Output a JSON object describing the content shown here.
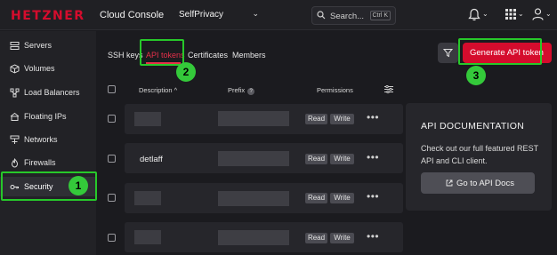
{
  "topbar": {
    "logo": "HETZNER",
    "app_title": "Cloud Console",
    "project": "SelfPrivacy",
    "search_placeholder": "Search...",
    "search_shortcut": "Ctrl K"
  },
  "sidebar": {
    "items": [
      {
        "label": "Servers",
        "icon": "server-icon"
      },
      {
        "label": "Volumes",
        "icon": "volume-icon"
      },
      {
        "label": "Load Balancers",
        "icon": "load-balancer-icon"
      },
      {
        "label": "Floating IPs",
        "icon": "floating-ip-icon"
      },
      {
        "label": "Networks",
        "icon": "network-icon"
      },
      {
        "label": "Firewalls",
        "icon": "firewall-icon"
      },
      {
        "label": "Security",
        "icon": "key-icon",
        "active": true
      }
    ]
  },
  "tabs": [
    {
      "label": "SSH keys"
    },
    {
      "label": "API tokens",
      "active": true
    },
    {
      "label": "Certificates"
    },
    {
      "label": "Members"
    }
  ],
  "actions": {
    "generate_label": "Generate API token"
  },
  "table": {
    "headers": {
      "description": "Description",
      "prefix": "Prefix",
      "permissions": "Permissions"
    },
    "sort_indicator": "^",
    "help_glyph": "?",
    "rows": [
      {
        "description": "",
        "perm_read": "Read",
        "perm_write": "Write",
        "more": "•••"
      },
      {
        "description": "detlaff",
        "perm_read": "Read",
        "perm_write": "Write",
        "more": "•••"
      },
      {
        "description": "",
        "perm_read": "Read",
        "perm_write": "Write",
        "more": "•••"
      },
      {
        "description": "",
        "perm_read": "Read",
        "perm_write": "Write",
        "more": "•••"
      }
    ]
  },
  "api_card": {
    "title": "API DOCUMENTATION",
    "description": "Check out our full featured REST API and CLI client.",
    "button_label": "Go to API Docs"
  },
  "annotations": {
    "badge_1": "1",
    "badge_2": "2",
    "badge_3": "3"
  },
  "colors": {
    "brand_red": "#d50c2d",
    "highlight_green": "#27c82a"
  }
}
